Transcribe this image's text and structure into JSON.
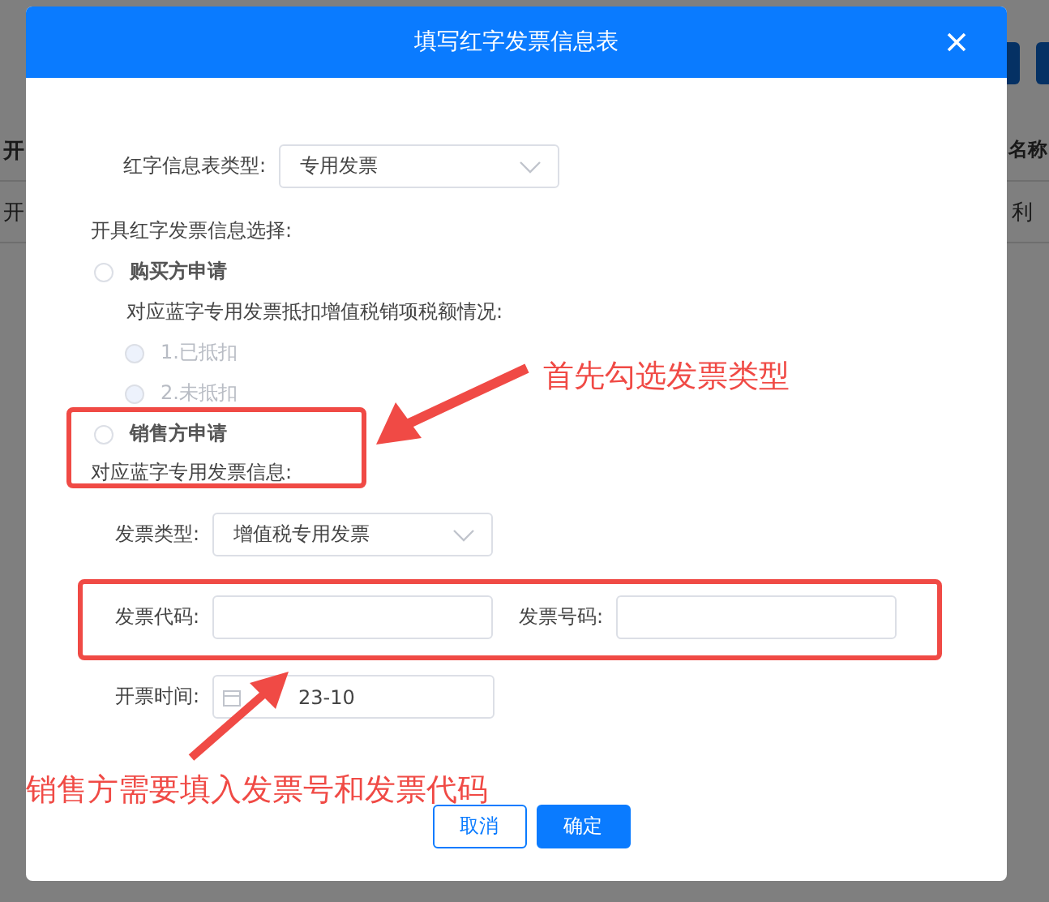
{
  "background": {
    "header_cells": [
      "开",
      "名称"
    ],
    "row_cells": [
      "开",
      "利"
    ]
  },
  "dialog": {
    "title": "填写红字发票信息表",
    "info_type": {
      "label": "红字信息表类型:",
      "value": "专用发票"
    },
    "choice_label": "开具红字发票信息选择:",
    "options": [
      {
        "label": "购买方申请",
        "selected": false,
        "note": "对应蓝字专用发票抵扣增值税销项税额情况:",
        "sub_options": [
          {
            "label": "1.已抵扣",
            "selected": false,
            "disabled": true
          },
          {
            "label": "2.未抵扣",
            "selected": false,
            "disabled": true
          }
        ]
      },
      {
        "label": "销售方申请",
        "selected": false,
        "note": "对应蓝字专用发票信息:"
      }
    ],
    "invoice_type": {
      "label": "发票类型:",
      "value": "增值税专用发票"
    },
    "invoice_code": {
      "label": "发票代码:"
    },
    "invoice_number": {
      "label": "发票号码:"
    },
    "issue_date": {
      "label": "开票时间:",
      "value": "23-10"
    },
    "buttons": [
      {
        "label": "取消",
        "kind": "secondary"
      },
      {
        "label": "确定",
        "kind": "primary"
      }
    ]
  },
  "annotations": [
    {
      "text": "首先勾选发票类型"
    },
    {
      "text": "销售方需要填入发票号和发票代码"
    }
  ]
}
